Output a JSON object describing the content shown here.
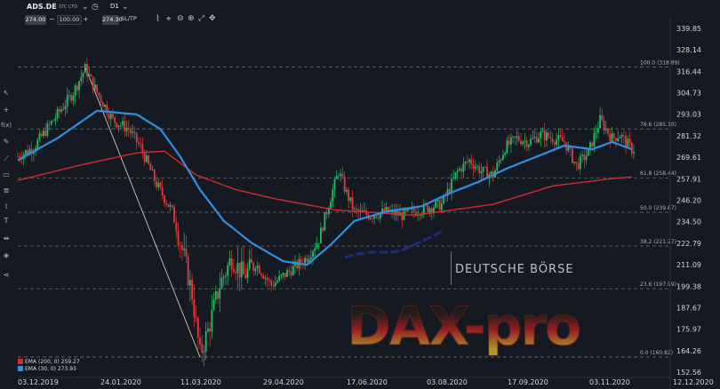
{
  "toolbar": {
    "symbol": "ADS.DE",
    "symbol_type": "STC CFD",
    "timeframe": "D1",
    "bid": "274.00",
    "quantity": "100.00",
    "ask": "274.30",
    "sltp_label": "SL/TP",
    "icons": [
      "chevron-down-icon",
      "clock-icon",
      "chevron-down-icon",
      "line-chart-icon",
      "crosshair-cursor-icon",
      "zoom-out-icon",
      "zoom-in-icon",
      "expand-icon",
      "move-icon"
    ]
  },
  "sidebar": {
    "icons": [
      "cursor-icon",
      "crosshair-icon",
      "function-icon",
      "pencil-icon",
      "trend-line-icon",
      "rectangle-icon",
      "fib-retracement-icon",
      "brush-icon",
      "text-icon",
      "measure-icon",
      "layers-icon",
      "share-icon"
    ]
  },
  "legend": [
    {
      "label": "EMA (200, 0) 259.27",
      "color": "#d12b2b"
    },
    {
      "label": "EMA (30, 0) 273.93",
      "color": "#2f8fe0"
    }
  ],
  "fib_levels": [
    {
      "label": "100.0 (318.89)",
      "price": 318.89
    },
    {
      "label": "78.6 (285.10)",
      "price": 285.1
    },
    {
      "label": "61.8 (258.44)",
      "price": 258.44
    },
    {
      "label": "50.0 (239.67)",
      "price": 239.67
    },
    {
      "label": "38.2 (221.27)",
      "price": 221.27
    },
    {
      "label": "23.6 (197.99)",
      "price": 197.99
    },
    {
      "label": "0.0 (160.82)",
      "price": 160.82
    }
  ],
  "watermark": {
    "brand": "DEUTSCHE BÖRSE",
    "logo_text": "DAX-pro"
  },
  "chart_data": {
    "type": "candlestick",
    "price_axis": [
      339.85,
      328.14,
      316.44,
      304.73,
      293.03,
      281.32,
      269.61,
      257.91,
      246.2,
      234.5,
      222.79,
      211.09,
      199.38,
      187.67,
      175.97,
      164.26,
      152.56
    ],
    "x_labels": [
      "03.12.2019",
      "24.01.2020",
      "11.03.2020",
      "29.04.2020",
      "17.06.2020",
      "03.08.2020",
      "17.09.2020",
      "03.11.2020",
      "12.12.2020"
    ],
    "ylim": [
      152.56,
      339.85
    ],
    "ohlc_anchors": [
      {
        "i": 0,
        "c": 270
      },
      {
        "i": 8,
        "c": 275
      },
      {
        "i": 18,
        "c": 290
      },
      {
        "i": 28,
        "c": 305
      },
      {
        "i": 34,
        "c": 318
      },
      {
        "i": 40,
        "c": 305
      },
      {
        "i": 48,
        "c": 290
      },
      {
        "i": 56,
        "c": 285
      },
      {
        "i": 62,
        "c": 275
      },
      {
        "i": 70,
        "c": 255
      },
      {
        "i": 78,
        "c": 240
      },
      {
        "i": 84,
        "c": 215
      },
      {
        "i": 88,
        "c": 195
      },
      {
        "i": 92,
        "c": 162
      },
      {
        "i": 96,
        "c": 175
      },
      {
        "i": 102,
        "c": 200
      },
      {
        "i": 108,
        "c": 215
      },
      {
        "i": 114,
        "c": 205
      },
      {
        "i": 120,
        "c": 212
      },
      {
        "i": 128,
        "c": 200
      },
      {
        "i": 134,
        "c": 205
      },
      {
        "i": 140,
        "c": 210
      },
      {
        "i": 146,
        "c": 215
      },
      {
        "i": 152,
        "c": 225
      },
      {
        "i": 158,
        "c": 248
      },
      {
        "i": 162,
        "c": 262
      },
      {
        "i": 166,
        "c": 250
      },
      {
        "i": 170,
        "c": 240
      },
      {
        "i": 178,
        "c": 238
      },
      {
        "i": 186,
        "c": 240
      },
      {
        "i": 194,
        "c": 238
      },
      {
        "i": 200,
        "c": 240
      },
      {
        "i": 206,
        "c": 242
      },
      {
        "i": 214,
        "c": 244
      },
      {
        "i": 222,
        "c": 262
      },
      {
        "i": 228,
        "c": 268
      },
      {
        "i": 234,
        "c": 262
      },
      {
        "i": 240,
        "c": 260
      },
      {
        "i": 246,
        "c": 275
      },
      {
        "i": 252,
        "c": 280
      },
      {
        "i": 258,
        "c": 278
      },
      {
        "i": 264,
        "c": 282
      },
      {
        "i": 270,
        "c": 280
      },
      {
        "i": 276,
        "c": 278
      },
      {
        "i": 282,
        "c": 265
      },
      {
        "i": 288,
        "c": 272
      },
      {
        "i": 294,
        "c": 290
      },
      {
        "i": 300,
        "c": 280
      },
      {
        "i": 304,
        "c": 282
      },
      {
        "i": 310,
        "c": 274
      }
    ],
    "ema30_anchors": [
      [
        0,
        268
      ],
      [
        20,
        280
      ],
      [
        40,
        295
      ],
      [
        60,
        293
      ],
      [
        72,
        285
      ],
      [
        82,
        270
      ],
      [
        92,
        252
      ],
      [
        104,
        235
      ],
      [
        118,
        223
      ],
      [
        134,
        213
      ],
      [
        146,
        211
      ],
      [
        158,
        222
      ],
      [
        170,
        235
      ],
      [
        186,
        240
      ],
      [
        204,
        243
      ],
      [
        218,
        250
      ],
      [
        232,
        256
      ],
      [
        248,
        264
      ],
      [
        262,
        270
      ],
      [
        276,
        276
      ],
      [
        290,
        274
      ],
      [
        300,
        278
      ],
      [
        310,
        274
      ]
    ],
    "ema200_anchors": [
      [
        0,
        257
      ],
      [
        30,
        265
      ],
      [
        60,
        272
      ],
      [
        74,
        273
      ],
      [
        90,
        260
      ],
      [
        110,
        252
      ],
      [
        130,
        247
      ],
      [
        160,
        241
      ],
      [
        200,
        238
      ],
      [
        240,
        244
      ],
      [
        270,
        254
      ],
      [
        300,
        258
      ],
      [
        310,
        259
      ]
    ],
    "trend_line": {
      "from": {
        "i": 34,
        "p": 318.89
      },
      "to": {
        "i": 92,
        "p": 160.82
      }
    }
  }
}
